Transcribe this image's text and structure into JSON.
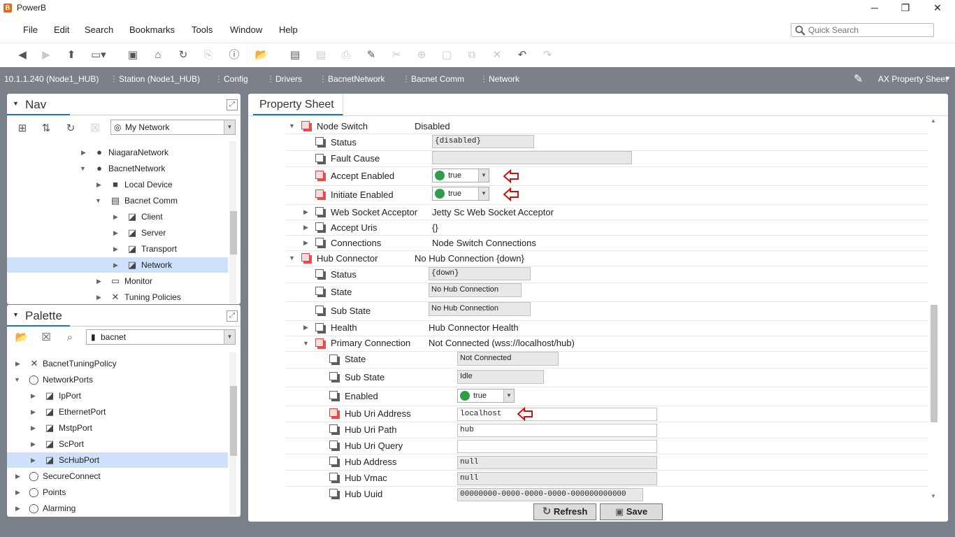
{
  "window": {
    "title": "PowerB",
    "app_icon": "B"
  },
  "menu": [
    "File",
    "Edit",
    "Search",
    "Bookmarks",
    "Tools",
    "Window",
    "Help"
  ],
  "quick_search": {
    "placeholder": "Quick Search"
  },
  "breadcrumbs": [
    "10.1.1.240 (Node1_HUB)",
    "Station (Node1_HUB)",
    "Config",
    "Drivers",
    "BacnetNetwork",
    "Bacnet Comm",
    "Network"
  ],
  "view_selector": {
    "label": "AX Property Sheet"
  },
  "nav": {
    "title": "Nav",
    "combo": "My Network",
    "tree": [
      {
        "label": "NiagaraNetwork"
      },
      {
        "label": "BacnetNetwork"
      },
      {
        "label": "Local Device"
      },
      {
        "label": "Bacnet Comm"
      },
      {
        "label": "Client"
      },
      {
        "label": "Server"
      },
      {
        "label": "Transport"
      },
      {
        "label": "Network"
      },
      {
        "label": "Monitor"
      },
      {
        "label": "Tuning Policies"
      }
    ]
  },
  "palette": {
    "title": "Palette",
    "combo": "bacnet",
    "tree": [
      {
        "label": "BacnetTuningPolicy"
      },
      {
        "label": "NetworkPorts"
      },
      {
        "label": "IpPort"
      },
      {
        "label": "EthernetPort"
      },
      {
        "label": "MstpPort"
      },
      {
        "label": "ScPort"
      },
      {
        "label": "ScHubPort"
      },
      {
        "label": "SecureConnect"
      },
      {
        "label": "Points"
      },
      {
        "label": "Alarming"
      }
    ]
  },
  "property_sheet": {
    "tab": "Property Sheet",
    "rows": [
      {
        "name": "Node Switch",
        "value": "Disabled"
      },
      {
        "name": "Status",
        "value": "{disabled}"
      },
      {
        "name": "Fault Cause",
        "value": ""
      },
      {
        "name": "Accept Enabled",
        "value": "true"
      },
      {
        "name": "Initiate Enabled",
        "value": "true"
      },
      {
        "name": "Web Socket Acceptor",
        "value": "Jetty Sc Web Socket Acceptor"
      },
      {
        "name": "Accept Uris",
        "value": "{}"
      },
      {
        "name": "Connections",
        "value": "Node Switch Connections"
      },
      {
        "name": "Hub Connector",
        "value": "No Hub Connection {down}"
      },
      {
        "name": "Status",
        "value": "{down}"
      },
      {
        "name": "State",
        "value": "No Hub Connection"
      },
      {
        "name": "Sub State",
        "value": "No Hub Connection"
      },
      {
        "name": "Health",
        "value": "Hub Connector Health"
      },
      {
        "name": "Primary Connection",
        "value": "Not Connected (wss://localhost/hub)"
      },
      {
        "name": "State",
        "value": "Not Connected"
      },
      {
        "name": "Sub State",
        "value": "Idle"
      },
      {
        "name": "Enabled",
        "value": "true"
      },
      {
        "name": "Hub Uri Address",
        "value": "localhost"
      },
      {
        "name": "Hub Uri Path",
        "value": "hub"
      },
      {
        "name": "Hub Uri Query",
        "value": ""
      },
      {
        "name": "Hub Address",
        "value": "null"
      },
      {
        "name": "Hub Vmac",
        "value": "null"
      },
      {
        "name": "Hub Uuid",
        "value": "00000000-0000-0000-0000-000000000000"
      }
    ]
  },
  "buttons": {
    "refresh": "Refresh",
    "save": "Save"
  },
  "colors": {
    "accent": "#1a73c9",
    "selection": "#cfe0fb",
    "status_green": "#2e9f48",
    "annotation_red": "#d01010",
    "pathbar": "#7c8088"
  }
}
